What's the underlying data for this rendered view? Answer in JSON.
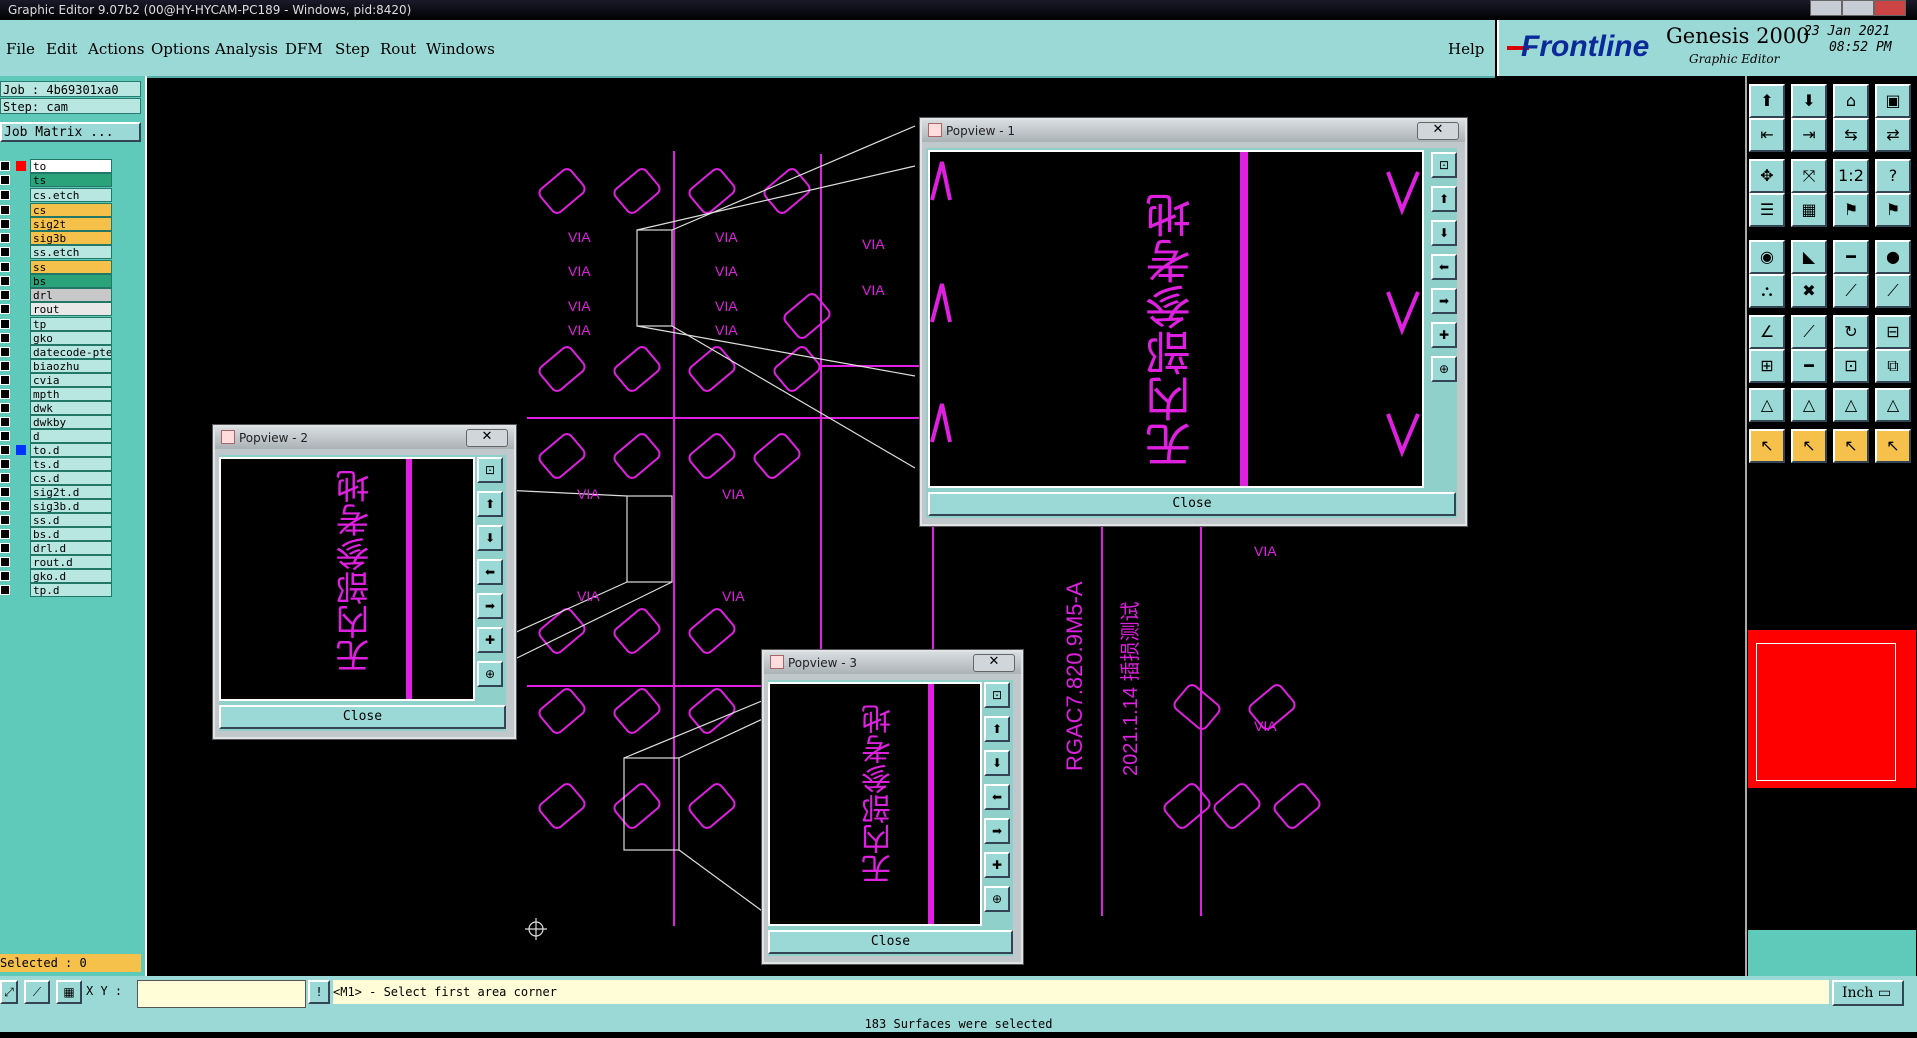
{
  "window": {
    "title": "Graphic Editor 9.07b2 (00@HY-HYCAM-PC189 - Windows, pid:8420)"
  },
  "menu": {
    "items": [
      "File",
      "Edit",
      "Actions",
      "Options",
      "Analysis",
      "DFM",
      "Step",
      "Rout",
      "Windows"
    ],
    "help": "Help"
  },
  "brand": {
    "logo": "Frontline",
    "product": "Genesis 2000",
    "subtitle": "Graphic Editor",
    "date": "23 Jan 2021",
    "time": "08:52 PM"
  },
  "left": {
    "job": "Job : 4b69301xa0",
    "step": "Step: cam",
    "matrix_button": "Job Matrix ...",
    "layers": [
      {
        "name": "to",
        "bg": "#ffffff"
      },
      {
        "name": "ts",
        "bg": "#2aa37a"
      },
      {
        "name": "cs.etch",
        "bg": "#b8e6e0"
      },
      {
        "name": "cs",
        "bg": "#f6c14a"
      },
      {
        "name": "sig2t",
        "bg": "#f6c14a"
      },
      {
        "name": "sig3b",
        "bg": "#f6c14a"
      },
      {
        "name": "ss.etch",
        "bg": "#b8e6e0"
      },
      {
        "name": "ss",
        "bg": "#f6c14a"
      },
      {
        "name": "bs",
        "bg": "#2aa37a"
      },
      {
        "name": "drl",
        "bg": "#c8c8c8"
      },
      {
        "name": "rout",
        "bg": "#e8e8e8"
      },
      {
        "name": "tp",
        "bg": "#b8e6e0"
      },
      {
        "name": "gko",
        "bg": "#b8e6e0"
      },
      {
        "name": "datecode-pte",
        "bg": "#b8e6e0"
      },
      {
        "name": "biaozhu",
        "bg": "#b8e6e0"
      },
      {
        "name": "cvia",
        "bg": "#b8e6e0"
      },
      {
        "name": "mpth",
        "bg": "#b8e6e0"
      },
      {
        "name": "dwk",
        "bg": "#b8e6e0"
      },
      {
        "name": "dwkby",
        "bg": "#b8e6e0"
      },
      {
        "name": "d",
        "bg": "#b8e6e0"
      },
      {
        "name": "to.d",
        "bg": "#b8e6e0"
      },
      {
        "name": "ts.d",
        "bg": "#b8e6e0"
      },
      {
        "name": "cs.d",
        "bg": "#b8e6e0"
      },
      {
        "name": "sig2t.d",
        "bg": "#b8e6e0"
      },
      {
        "name": "sig3b.d",
        "bg": "#b8e6e0"
      },
      {
        "name": "ss.d",
        "bg": "#b8e6e0"
      },
      {
        "name": "bs.d",
        "bg": "#b8e6e0"
      },
      {
        "name": "drl.d",
        "bg": "#b8e6e0"
      },
      {
        "name": "rout.d",
        "bg": "#b8e6e0"
      },
      {
        "name": "gko.d",
        "bg": "#b8e6e0"
      },
      {
        "name": "tp.d",
        "bg": "#b8e6e0"
      }
    ],
    "selected": "Selected : 0"
  },
  "canvas": {
    "via_label": "VIA",
    "part_text": "RGAC7.820.9M5-A",
    "date_text": "2021.1.14 插损测试",
    "cn_text": "无内部参考地",
    "cn_text_partial": "无内部参考地",
    "color": "#e020e0"
  },
  "popviews": [
    {
      "title": "Popview - 1",
      "close": "Close"
    },
    {
      "title": "Popview - 2",
      "close": "Close"
    },
    {
      "title": "Popview - 3",
      "close": "Close"
    }
  ],
  "bottom": {
    "xy_label": "X Y :",
    "xy_value": "",
    "message": "<M1> - Select first area corner",
    "status": "183 Surfaces were selected",
    "units": "Inch"
  }
}
